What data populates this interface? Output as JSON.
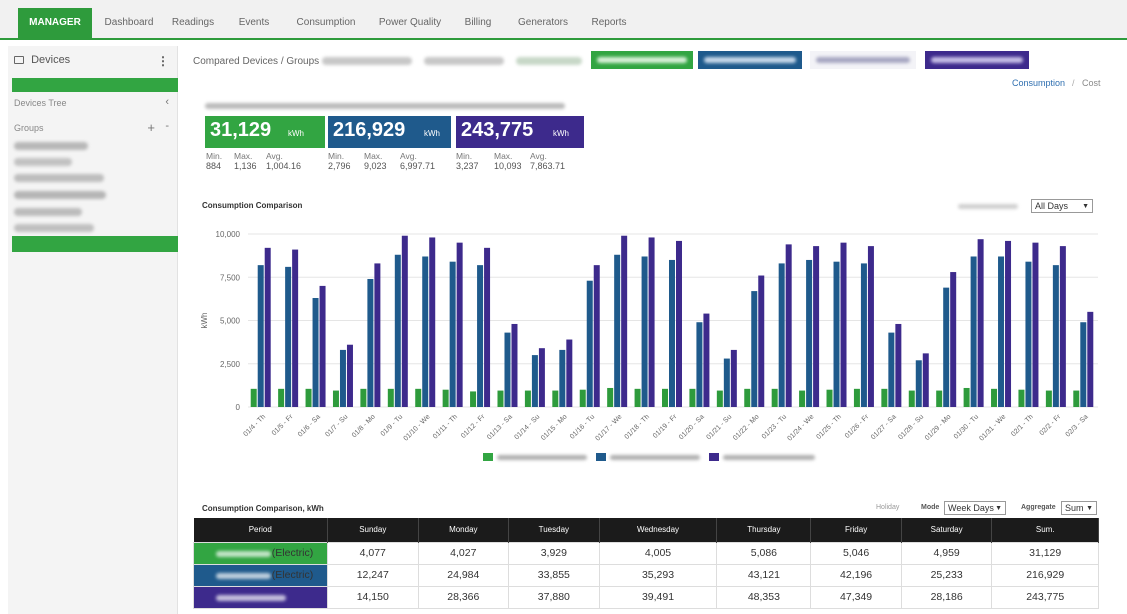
{
  "nav": {
    "tabs": [
      {
        "label": "MANAGER"
      },
      {
        "label": "Dashboard"
      },
      {
        "label": "Readings"
      },
      {
        "label": "Events"
      },
      {
        "label": "Consumption"
      },
      {
        "label": "Power Quality"
      },
      {
        "label": "Billing"
      },
      {
        "label": "Generators"
      },
      {
        "label": "Reports"
      }
    ]
  },
  "sidebar": {
    "title": "Devices",
    "devices_tree": "Devices Tree",
    "groups": "Groups",
    "add": "+",
    "collapse": "-",
    "chevron": "‹"
  },
  "compared": {
    "label": "Compared Devices / Groups",
    "toggle_consumption": "Consumption",
    "toggle_separator": "/",
    "toggle_cost": "Cost"
  },
  "kpis": [
    {
      "value": "31,129",
      "unit": "kWh",
      "min_label": "Min.",
      "max_label": "Max.",
      "avg_label": "Avg.",
      "min": "884",
      "max": "1,136",
      "avg": "1,004.16"
    },
    {
      "value": "216,929",
      "unit": "kWh",
      "min_label": "Min.",
      "max_label": "Max.",
      "avg_label": "Avg.",
      "min": "2,796",
      "max": "9,023",
      "avg": "6,997.71"
    },
    {
      "value": "243,775",
      "unit": "kWh",
      "min_label": "Min.",
      "max_label": "Max.",
      "avg_label": "Avg.",
      "min": "3,237",
      "max": "10,093",
      "avg": "7,863.71"
    }
  ],
  "chart_section": {
    "title": "Consumption Comparison",
    "unit_label": "Unit",
    "select_value": "All Days"
  },
  "chart_data": {
    "type": "bar",
    "ylabel": "kWh",
    "ylim": [
      0,
      10000
    ],
    "yticks": [
      "0",
      "2,500",
      "5,000",
      "7,500",
      "10,000"
    ],
    "categories": [
      "01/4 - Th",
      "01/5 - Fr",
      "01/6 - Sa",
      "01/7 - Su",
      "01/8 - Mo",
      "01/9 - Tu",
      "01/10 - We",
      "01/11 - Th",
      "01/12 - Fr",
      "01/13 - Sa",
      "01/14 - Su",
      "01/15 - Mo",
      "01/16 - Tu",
      "01/17 - We",
      "01/18 - Th",
      "01/19 - Fr",
      "01/20 - Sa",
      "01/21 - Su",
      "01/22 - Mo",
      "01/23 - Tu",
      "01/24 - We",
      "01/25 - Th",
      "01/26 - Fr",
      "01/27 - Sa",
      "01/28 - Su",
      "01/29 - Mo",
      "01/30 - Tu",
      "01/31 - We",
      "02/1 - Th",
      "02/2 - Fr",
      "02/3 - Sa"
    ],
    "series": [
      {
        "color": "#2e9b3c",
        "values": [
          1050,
          1050,
          1050,
          950,
          1050,
          1050,
          1050,
          1000,
          900,
          950,
          950,
          950,
          1000,
          1100,
          1050,
          1050,
          1050,
          950,
          1050,
          1050,
          950,
          1000,
          1050,
          1050,
          950,
          950,
          1100,
          1050,
          1000,
          950,
          950
        ]
      },
      {
        "color": "#1f5a8c",
        "values": [
          8200,
          8100,
          6300,
          3300,
          7400,
          8800,
          8700,
          8400,
          8200,
          4300,
          3000,
          3300,
          7300,
          8800,
          8700,
          8500,
          4900,
          2800,
          6700,
          8300,
          8500,
          8400,
          8300,
          4300,
          2700,
          6900,
          8700,
          8700,
          8400,
          8200,
          4900
        ]
      },
      {
        "color": "#3d2a8c",
        "values": [
          9200,
          9100,
          7000,
          3600,
          8300,
          9900,
          9800,
          9500,
          9200,
          4800,
          3400,
          3900,
          8200,
          9900,
          9800,
          9600,
          5400,
          3300,
          7600,
          9400,
          9300,
          9500,
          9300,
          4800,
          3100,
          7800,
          9700,
          9600,
          9500,
          9300,
          5500
        ]
      }
    ]
  },
  "table_section": {
    "title": "Consumption Comparison, kWh",
    "holiday_label": "Holiday",
    "mode_label": "Mode",
    "mode_value": "Week Days",
    "aggregate_label": "Aggregate",
    "aggregate_value": "Sum"
  },
  "table": {
    "headers": [
      "Period",
      "Sunday",
      "Monday",
      "Tuesday",
      "Wednesday",
      "Thursday",
      "Friday",
      "Saturday",
      "Sum."
    ],
    "rows": [
      {
        "period": "(Electric)",
        "color": "#2e9b3c",
        "cells": [
          "4,077",
          "4,027",
          "3,929",
          "4,005",
          "5,086",
          "5,046",
          "4,959",
          "31,129"
        ]
      },
      {
        "period": "(Electric)",
        "color": "#1f5a8c",
        "cells": [
          "12,247",
          "24,984",
          "33,855",
          "35,293",
          "43,121",
          "42,196",
          "25,233",
          "216,929"
        ]
      },
      {
        "period": "",
        "color": "#3d2a8c",
        "cells": [
          "14,150",
          "28,366",
          "37,880",
          "39,491",
          "48,353",
          "47,349",
          "28,186",
          "243,775"
        ]
      }
    ]
  },
  "colors": {
    "green": "#2e9b3c",
    "blue": "#1f5a8c",
    "purple": "#3d2a8c"
  }
}
